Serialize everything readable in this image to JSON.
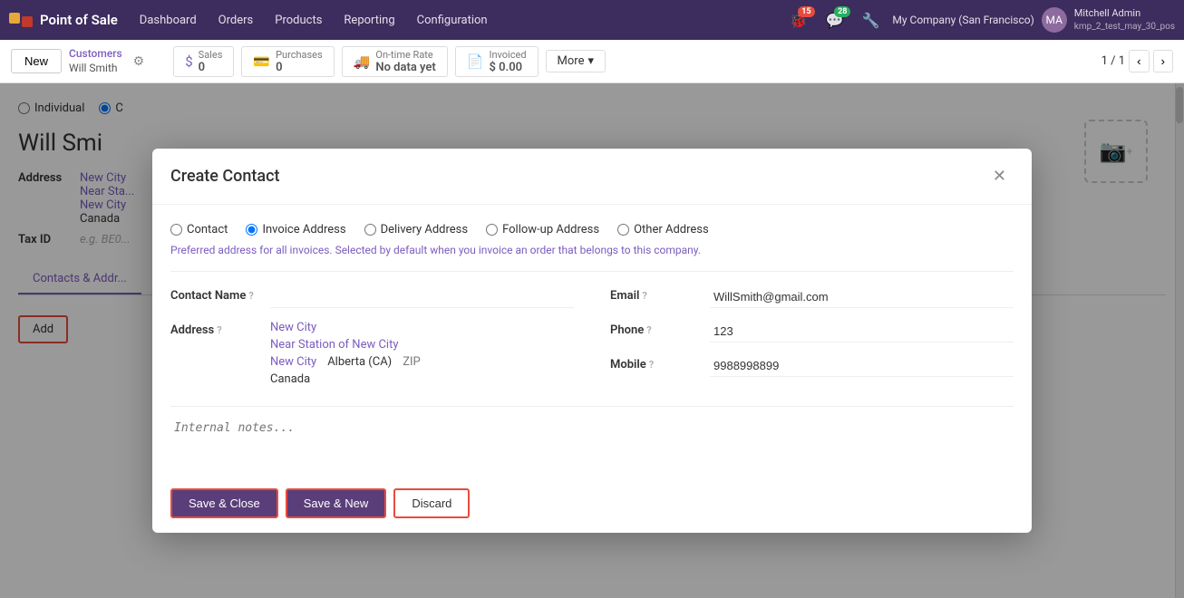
{
  "navbar": {
    "brand": "Point of Sale",
    "nav_items": [
      "Dashboard",
      "Orders",
      "Products",
      "Reporting",
      "Configuration"
    ],
    "bug_count": "15",
    "msg_count": "28",
    "company": "My Company (San Francisco)",
    "user_name": "Mitchell Admin",
    "user_db": "kmp_2_test_may_30_pos"
  },
  "action_bar": {
    "new_label": "New",
    "breadcrumb_top": "Customers",
    "breadcrumb_sub": "Will Smith",
    "stats": [
      {
        "icon": "$",
        "label": "Sales",
        "value": "0"
      },
      {
        "icon": "💳",
        "label": "Purchases",
        "value": "0"
      },
      {
        "icon": "🚚",
        "label": "On-time Rate",
        "value": "No data yet"
      },
      {
        "icon": "📄",
        "label": "Invoiced",
        "value": "$ 0.00"
      }
    ],
    "more_label": "More",
    "pagination": "1 / 1"
  },
  "bg_form": {
    "radio_options": [
      "Individual",
      "Company"
    ],
    "name": "Will Smi",
    "address_label": "Address",
    "address_lines": [
      "New City",
      "Near Sta...",
      "New City",
      "Canada"
    ],
    "tax_id_label": "Tax ID",
    "tax_id_placeholder": "e.g. BE0...",
    "tab_label": "Contacts & Addr..."
  },
  "modal": {
    "title": "Create Contact",
    "address_types": [
      {
        "value": "contact",
        "label": "Contact"
      },
      {
        "value": "invoice",
        "label": "Invoice Address",
        "checked": true
      },
      {
        "value": "delivery",
        "label": "Delivery Address"
      },
      {
        "value": "followup",
        "label": "Follow-up Address"
      },
      {
        "value": "other",
        "label": "Other Address"
      }
    ],
    "addr_hint": "Preferred address for all invoices. Selected by default when you invoice an order that belongs to this company.",
    "fields": {
      "contact_name_label": "Contact Name",
      "contact_name_value": "",
      "address_label": "Address",
      "address_line1": "New City",
      "address_line2": "Near Station of New City",
      "address_city": "New City",
      "address_state": "Alberta (CA)",
      "address_zip": "ZIP",
      "address_country": "Canada",
      "email_label": "Email",
      "email_value": "WillSmith@gmail.com",
      "phone_label": "Phone",
      "phone_value": "123",
      "mobile_label": "Mobile",
      "mobile_value": "9988998899"
    },
    "notes_placeholder": "Internal notes...",
    "save_close_label": "Save & Close",
    "save_new_label": "Save & New",
    "discard_label": "Discard"
  }
}
